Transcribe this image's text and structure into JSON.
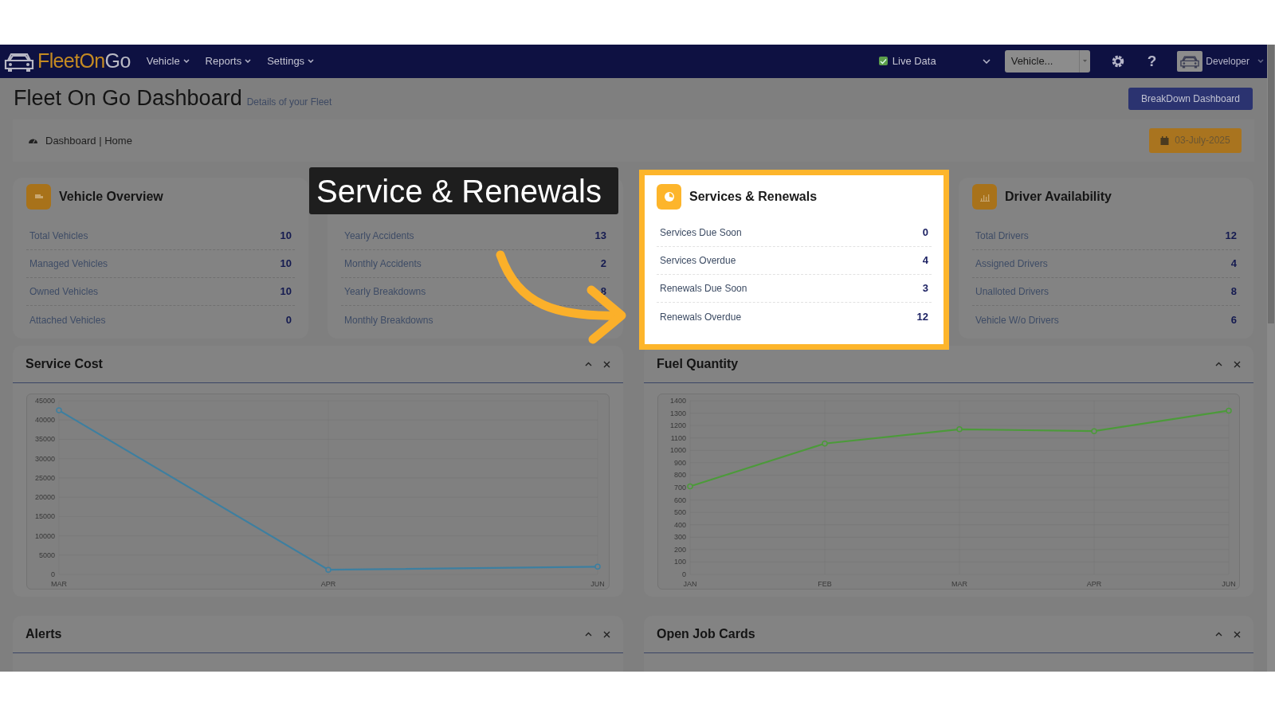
{
  "navbar": {
    "logo_parts": [
      "Fleet",
      "On",
      "Go"
    ],
    "menus": [
      {
        "label": "Vehicle"
      },
      {
        "label": "Reports"
      },
      {
        "label": "Settings"
      }
    ],
    "live_data": {
      "label": "Live Data",
      "checked": true
    },
    "vehicle_select": {
      "value": "Vehicle..."
    },
    "help": "?",
    "user": "Developer"
  },
  "header": {
    "title": "Fleet On Go Dashboard",
    "subtitle": "Details of your Fleet",
    "button": "BreakDown Dashboard"
  },
  "breadcrumb": {
    "text": "Dashboard | Home",
    "date": "03-July-2025"
  },
  "callout": "Service & Renewals",
  "cards": [
    {
      "title": "Vehicle Overview",
      "highlighted": false,
      "rows": [
        {
          "label": "Total Vehicles",
          "value": "10"
        },
        {
          "label": "Managed Vehicles",
          "value": "10"
        },
        {
          "label": "Owned Vehicles",
          "value": "10"
        },
        {
          "label": "Attached Vehicles",
          "value": "0"
        }
      ]
    },
    {
      "highlighted": false,
      "rows": [
        {
          "label": "Yearly Accidents",
          "value": "13"
        },
        {
          "label": "Monthly Accidents",
          "value": "2"
        },
        {
          "label": "Yearly Breakdowns",
          "value": "8"
        },
        {
          "label": "Monthly Breakdowns"
        }
      ]
    },
    {
      "title": "Services & Renewals",
      "highlighted": true,
      "rows": [
        {
          "label": "Services Due Soon",
          "value": "0"
        },
        {
          "label": "Services Overdue",
          "value": "4"
        },
        {
          "label": "Renewals Due Soon",
          "value": "3"
        },
        {
          "label": "Renewals Overdue",
          "value": "12"
        }
      ]
    },
    {
      "title": "Driver Availability",
      "highlighted": false,
      "rows": [
        {
          "label": "Total Drivers",
          "value": "12"
        },
        {
          "label": "Assigned Drivers",
          "value": "4"
        },
        {
          "label": "Unalloted Drivers",
          "value": "8"
        },
        {
          "label": "Vehicle W/o Drivers",
          "value": "6"
        }
      ]
    }
  ],
  "panels": [
    {
      "title": "Service Cost",
      "chart_data": {
        "type": "line",
        "grid": true,
        "categories": [
          "MAR",
          "APR",
          "JUN"
        ],
        "series": [
          {
            "color": "#3d7fa0",
            "marker": true,
            "values": [
              42500,
              1200,
              2000
            ]
          }
        ],
        "ylim": [
          0,
          45000
        ],
        "yticks": [
          0,
          5000,
          10000,
          15000,
          20000,
          25000,
          30000,
          35000,
          40000,
          45000
        ]
      }
    },
    {
      "title": "Fuel Quantity",
      "chart_data": {
        "type": "line",
        "grid": true,
        "categories": [
          "JAN",
          "FEB",
          "MAR",
          "APR",
          "JUN"
        ],
        "series": [
          {
            "color": "#4c9a3a",
            "marker": true,
            "values": [
              710,
              1055,
              1170,
              1155,
              1320
            ]
          }
        ],
        "ylim": [
          0,
          1400
        ],
        "yticks": [
          0,
          100,
          200,
          300,
          400,
          500,
          600,
          700,
          800,
          900,
          1000,
          1100,
          1200,
          1300,
          1400
        ]
      }
    },
    {
      "title": "Alerts"
    },
    {
      "title": "Open Job Cards"
    }
  ]
}
